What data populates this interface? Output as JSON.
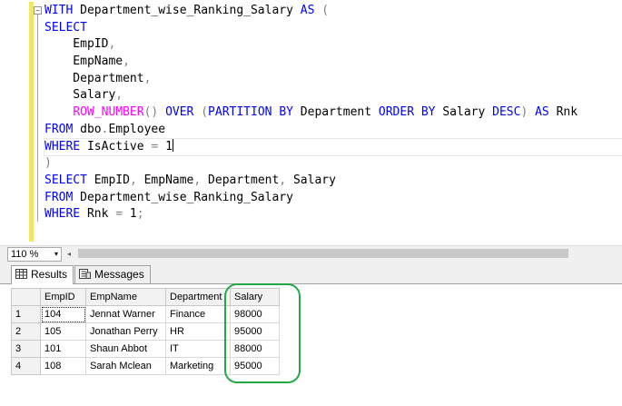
{
  "editor": {
    "collapse_glyph": "−",
    "lines": [
      [
        [
          "kw",
          "WITH"
        ],
        [
          "t",
          " Department_wise_Ranking_Salary "
        ],
        [
          "kw",
          "AS"
        ],
        [
          "t",
          " "
        ],
        [
          "gr",
          "("
        ]
      ],
      [
        [
          "kw",
          "SELECT"
        ]
      ],
      [
        [
          "t",
          "    EmpID"
        ],
        [
          "gr",
          ","
        ]
      ],
      [
        [
          "t",
          "    EmpName"
        ],
        [
          "gr",
          ","
        ]
      ],
      [
        [
          "t",
          "    Department"
        ],
        [
          "gr",
          ","
        ]
      ],
      [
        [
          "t",
          "    Salary"
        ],
        [
          "gr",
          ","
        ]
      ],
      [
        [
          "t",
          "    "
        ],
        [
          "fn",
          "ROW_NUMBER"
        ],
        [
          "gr",
          "()"
        ],
        [
          "t",
          " "
        ],
        [
          "kw",
          "OVER"
        ],
        [
          "t",
          " "
        ],
        [
          "gr",
          "("
        ],
        [
          "kw",
          "PARTITION BY"
        ],
        [
          "t",
          " Department "
        ],
        [
          "kw",
          "ORDER BY"
        ],
        [
          "t",
          " Salary "
        ],
        [
          "kw",
          "DESC"
        ],
        [
          "gr",
          ")"
        ],
        [
          "t",
          " "
        ],
        [
          "kw",
          "AS"
        ],
        [
          "t",
          " Rnk"
        ]
      ],
      [
        [
          "kw",
          "FROM"
        ],
        [
          "t",
          " dbo"
        ],
        [
          "gr",
          "."
        ],
        [
          "t",
          "Employee"
        ]
      ],
      [
        [
          "kw",
          "WHERE"
        ],
        [
          "t",
          " IsActive "
        ],
        [
          "gr",
          "="
        ],
        [
          "t",
          " 1"
        ],
        [
          "cursor",
          ""
        ]
      ],
      [
        [
          "gr",
          ")"
        ]
      ],
      [
        [
          "kw",
          "SELECT"
        ],
        [
          "t",
          " EmpID"
        ],
        [
          "gr",
          ","
        ],
        [
          "t",
          " EmpName"
        ],
        [
          "gr",
          ","
        ],
        [
          "t",
          " Department"
        ],
        [
          "gr",
          ","
        ],
        [
          "t",
          " Salary"
        ]
      ],
      [
        [
          "kw",
          "FROM"
        ],
        [
          "t",
          " Department_wise_Ranking_Salary"
        ]
      ],
      [
        [
          "kw",
          "WHERE"
        ],
        [
          "t",
          " Rnk "
        ],
        [
          "gr",
          "="
        ],
        [
          "t",
          " 1"
        ],
        [
          "gr",
          ";"
        ]
      ]
    ],
    "current_line": 8
  },
  "zoom": {
    "value": "110 %",
    "arrow": "▾",
    "scroll_left_arrow": "◂"
  },
  "tabs": [
    {
      "label": "Results",
      "icon": "grid-icon",
      "active": true
    },
    {
      "label": "Messages",
      "icon": "messages-icon",
      "active": false
    }
  ],
  "grid": {
    "columns": [
      "",
      "EmpID",
      "EmpName",
      "Department",
      "Salary"
    ],
    "rows": [
      [
        "1",
        "104",
        "Jennat Warner",
        "Finance",
        "98000"
      ],
      [
        "2",
        "105",
        "Jonathan Perry",
        "HR",
        "95000"
      ],
      [
        "3",
        "101",
        "Shaun Abbot",
        "IT",
        "88000"
      ],
      [
        "4",
        "108",
        "Sarah Mclean",
        "Marketing",
        "95000"
      ]
    ]
  },
  "colors": {
    "keyword": "#0000ff",
    "function": "#ff00ff",
    "operator": "#808080",
    "highlight_ring": "#22a845",
    "change_bar": "#f3e566"
  }
}
